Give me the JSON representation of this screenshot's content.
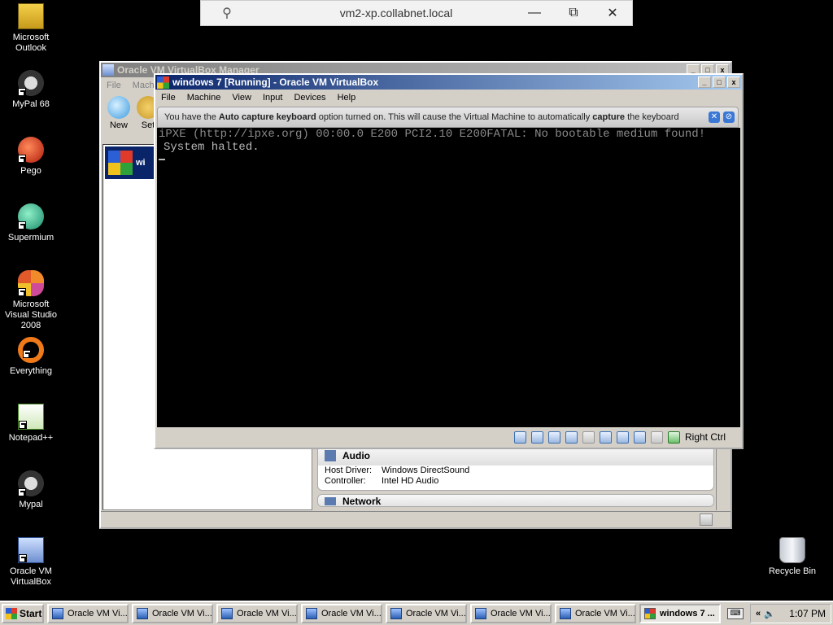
{
  "rdp_bar": {
    "title": "vm2-xp.collabnet.local",
    "pin_glyph": "⚲",
    "minimize_glyph": "—",
    "restore_glyph": "⧉",
    "close_glyph": "✕"
  },
  "desktop_icons": [
    {
      "label": "Microsoft Outlook",
      "icon": "outlook-icon"
    },
    {
      "label": "MyPal 68",
      "icon": "mypal-icon"
    },
    {
      "label": "Pego",
      "icon": "pego-icon"
    },
    {
      "label": "Supermium",
      "icon": "supermium-icon"
    },
    {
      "label": "Microsoft Visual Studio 2008",
      "icon": "visual-studio-icon"
    },
    {
      "label": "Everything",
      "icon": "everything-icon"
    },
    {
      "label": "Notepad++",
      "icon": "notepad-plus-plus-icon"
    },
    {
      "label": "Mypal",
      "icon": "mypal-icon"
    },
    {
      "label": "Oracle VM VirtualBox",
      "icon": "virtualbox-icon"
    },
    {
      "label": "Recycle Bin",
      "icon": "recycle-bin-icon"
    }
  ],
  "manager": {
    "title": "Oracle VM VirtualBox Manager",
    "menu": [
      "File",
      "Machi"
    ],
    "toolbar": [
      {
        "label": "New"
      },
      {
        "label": "Set"
      }
    ],
    "vm_item": {
      "name": "wi"
    },
    "audio": {
      "heading": "Audio",
      "rows": [
        {
          "key": "Host Driver:",
          "value": "Windows DirectSound"
        },
        {
          "key": "Controller:",
          "value": "Intel HD Audio"
        }
      ]
    },
    "network_heading": "Network"
  },
  "vm_window": {
    "title": "windows 7 [Running] - Oracle VM VirtualBox",
    "menu": [
      "File",
      "Machine",
      "View",
      "Input",
      "Devices",
      "Help"
    ],
    "notice": {
      "prefix": "You have the ",
      "bold1": "Auto capture keyboard",
      "middle": " option turned on. This will cause the Virtual Machine to automatically ",
      "bold2": "capture",
      "suffix": " the keyboard"
    },
    "console": {
      "line1": "iPXE (http://ipxe.org) 00:00.0 E200 PCI2.10 E200FATAL: No bootable medium found!",
      "line2": "System halted."
    },
    "host_key": "Right Ctrl"
  },
  "taskbar": {
    "start_label": "Start",
    "tasks": [
      {
        "label": "Oracle VM Vi...",
        "active": false
      },
      {
        "label": "Oracle VM Vi...",
        "active": false
      },
      {
        "label": "Oracle VM Vi...",
        "active": false
      },
      {
        "label": "Oracle VM Vi...",
        "active": false
      },
      {
        "label": "Oracle VM Vi...",
        "active": false
      },
      {
        "label": "Oracle VM Vi...",
        "active": false
      },
      {
        "label": "Oracle VM Vi...",
        "active": false
      },
      {
        "label": "windows 7 ...",
        "active": true
      }
    ],
    "tray_chevron": "«",
    "clock": "1:07 PM"
  }
}
